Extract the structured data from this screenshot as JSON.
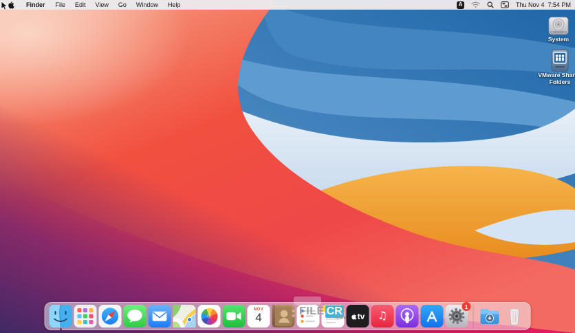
{
  "menu_bar": {
    "items": [
      "Finder",
      "File",
      "Edit",
      "View",
      "Go",
      "Window",
      "Help"
    ],
    "active_app": "Finder",
    "input_source_label": "A",
    "status_icons": [
      "input-source",
      "wifi",
      "spotlight",
      "control-center"
    ],
    "clock": "Thu Nov 4  7:54 PM"
  },
  "desktop": {
    "icons": [
      {
        "label": "System",
        "kind": "internal-drive"
      },
      {
        "label": "VMware Shared Folders",
        "kind": "network-drive"
      }
    ]
  },
  "dock": {
    "apps": [
      {
        "name": "Finder",
        "running": true
      },
      {
        "name": "Launchpad"
      },
      {
        "name": "Safari"
      },
      {
        "name": "Messages"
      },
      {
        "name": "Mail"
      },
      {
        "name": "Maps"
      },
      {
        "name": "Photos"
      },
      {
        "name": "FaceTime"
      },
      {
        "name": "Calendar",
        "month": "NOV",
        "day": "4"
      },
      {
        "name": "Contacts"
      },
      {
        "name": "Reminders"
      },
      {
        "name": "Notes"
      },
      {
        "name": "TV",
        "label": "tv"
      },
      {
        "name": "Music"
      },
      {
        "name": "Podcasts"
      },
      {
        "name": "App Store"
      },
      {
        "name": "System Preferences",
        "badge": "1"
      }
    ],
    "downloads_name": "Downloads",
    "trash_name": "Trash"
  },
  "watermark": {
    "part1": "FILE",
    "part2": "CR",
    "suffix": ".com"
  },
  "colors": {
    "menu_bar_bg": "#e9e7ea",
    "dock_bg": "rgba(243,243,246,0.52)",
    "watermark_accent": "#29abe2",
    "badge_red": "#ef3b30",
    "wallpaper_blue": "#2268ab",
    "wallpaper_red": "#f1503f",
    "wallpaper_magenta": "#e0125f",
    "wallpaper_purple": "#3f2a63",
    "wallpaper_orange": "#eda23f"
  }
}
